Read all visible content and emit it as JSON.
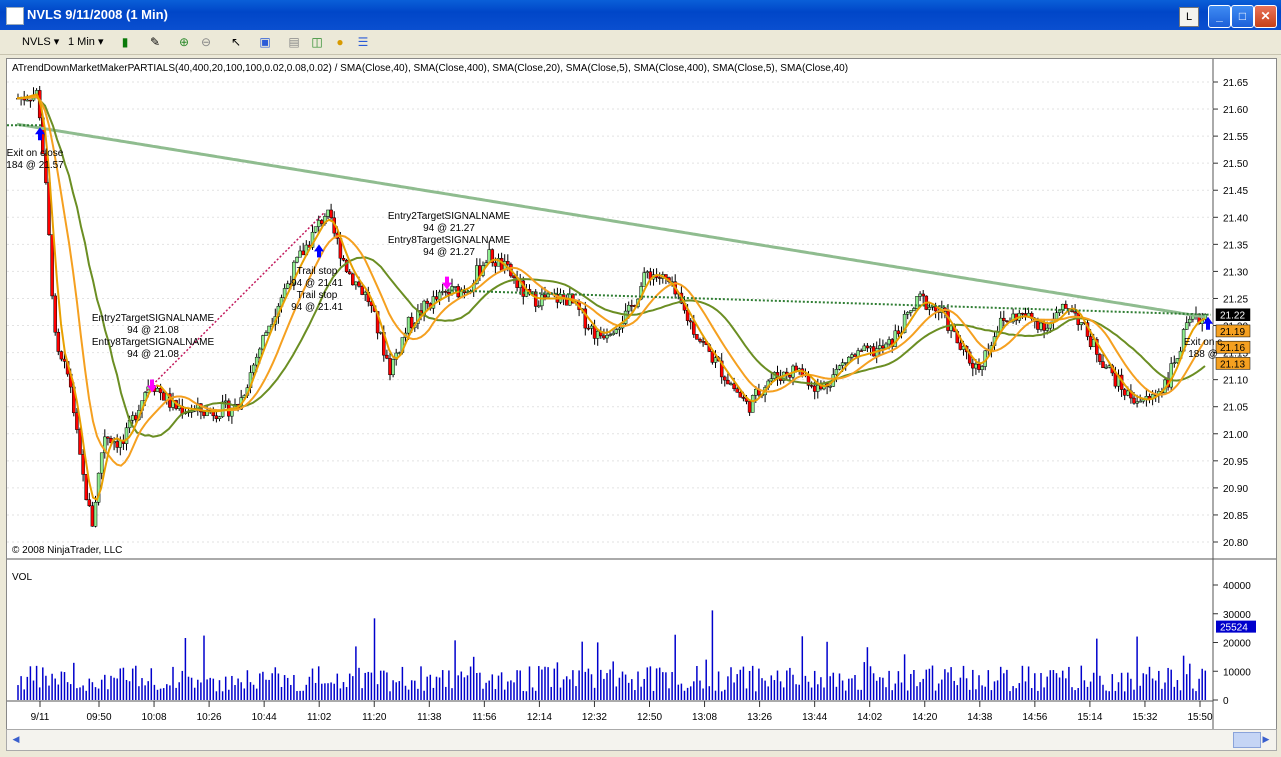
{
  "window": {
    "title": "NVLS  9/11/2008 (1 Min)",
    "l_button": "L"
  },
  "toolbar": {
    "instrument": "NVLS",
    "interval": "1 Min",
    "icons": [
      "bar-chart-icon",
      "pencil-icon",
      "zoom-in-icon",
      "zoom-out-icon",
      "pointer-icon",
      "properties-icon",
      "data-box-icon",
      "indicators-icon",
      "strategy-icon",
      "list-icon"
    ]
  },
  "chart": {
    "indicator_label": "ATrendDownMarketMakerPARTIALS(40,400,20,100,100,0.02,0.08,0.02) / SMA(Close,40), SMA(Close,400), SMA(Close,20), SMA(Close,5), SMA(Close,400), SMA(Close,5), SMA(Close,40)",
    "copyright": "© 2008 NinjaTrader, LLC",
    "volume_label": "VOL",
    "price_ticks": [
      "21.65",
      "21.60",
      "21.55",
      "21.50",
      "21.45",
      "21.40",
      "21.35",
      "21.30",
      "21.25",
      "21.20",
      "21.15",
      "21.10",
      "21.05",
      "21.00",
      "20.95",
      "20.90",
      "20.85",
      "20.80"
    ],
    "price_badges": [
      {
        "value": "21.22",
        "color": "#000000",
        "text_color": "#ffffff"
      },
      {
        "value": "21.19",
        "color": "#f5a020",
        "text_color": "#000000"
      },
      {
        "value": "21.16",
        "color": "#f5a020",
        "text_color": "#000000"
      },
      {
        "value": "21.13",
        "color": "#f5a020",
        "text_color": "#000000"
      }
    ],
    "volume_ticks": [
      "40000",
      "30000",
      "20000",
      "10000",
      "0"
    ],
    "volume_badge": "25524",
    "time_ticks": [
      "9/11",
      "09:50",
      "10:08",
      "10:26",
      "10:44",
      "11:02",
      "11:20",
      "11:38",
      "11:56",
      "12:14",
      "12:32",
      "12:50",
      "13:08",
      "13:26",
      "13:44",
      "14:02",
      "14:20",
      "14:38",
      "14:56",
      "15:14",
      "15:32",
      "15:50"
    ],
    "annotations": [
      {
        "lines": [
          "Exit on close",
          "184 @ 21.57"
        ]
      },
      {
        "lines": [
          "Entry2TargetSIGNALNAME",
          "94 @ 21.08",
          "Entry8TargetSIGNALNAME",
          "94 @ 21.08"
        ]
      },
      {
        "lines": [
          "Trail stop",
          "94 @ 21.41",
          "Trail stop",
          "94 @ 21.41"
        ]
      },
      {
        "lines": [
          "Entry2TargetSIGNALNAME",
          "94 @ 21.27",
          "Entry8TargetSIGNALNAME",
          "94 @ 21.27"
        ]
      },
      {
        "lines": [
          "Exit on c",
          "188 @"
        ]
      }
    ],
    "colors": {
      "candle_up": "#90ee90",
      "candle_down": "#ff0000",
      "sma400": "#8fbc8f",
      "sma40": "#6b8e23",
      "sma20": "#f5a020",
      "sma5": "#e8a000",
      "volume_bar": "#0000cc",
      "buy_arrow": "#0000ff",
      "sell_arrow": "#ff00ff"
    }
  }
}
